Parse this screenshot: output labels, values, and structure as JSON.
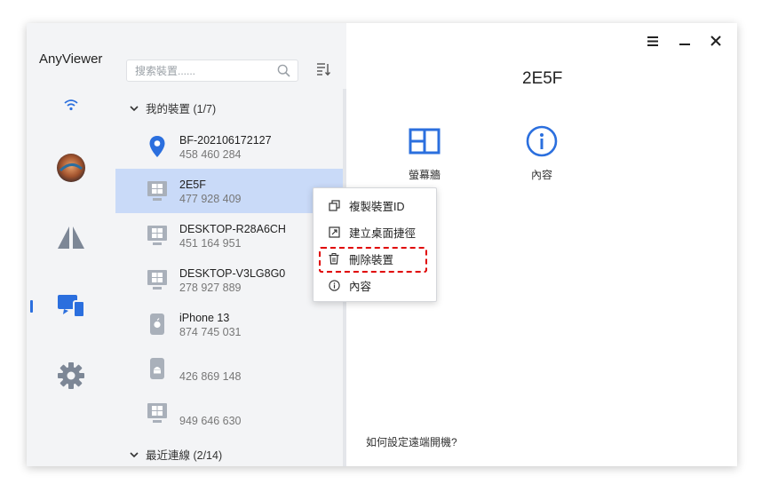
{
  "app": {
    "title": "AnyViewer"
  },
  "rail": {
    "items": [
      {
        "icon": "wifi-icon"
      },
      {
        "icon": "avatar"
      },
      {
        "icon": "remote-control-icon"
      },
      {
        "icon": "devices-icon",
        "active": true
      },
      {
        "icon": "gear-icon"
      }
    ]
  },
  "search": {
    "placeholder": "搜索裝置......",
    "value": ""
  },
  "groups": {
    "my_devices": "我的裝置 (1/7)",
    "recent": "最近連線 (2/14)"
  },
  "devices": [
    {
      "name": "BF-202106172127",
      "id": "458 460 284",
      "icon": "location-pin-icon"
    },
    {
      "name": "2E5F",
      "id": "477 928 409",
      "icon": "windows-pc-icon",
      "selected": true
    },
    {
      "name": "DESKTOP-R28A6CH",
      "id": "451 164 951",
      "icon": "windows-pc-icon"
    },
    {
      "name": "DESKTOP-V3LG8G0",
      "id": "278 927 889",
      "icon": "windows-pc-icon"
    },
    {
      "name": "iPhone 13",
      "id": "874 745 031",
      "icon": "apple-phone-icon"
    },
    {
      "name": "",
      "id": "426 869 148",
      "icon": "android-phone-icon"
    },
    {
      "name": "",
      "id": "949 646 630",
      "icon": "windows-pc-icon"
    }
  ],
  "detail": {
    "title": "2E5F",
    "actions": [
      {
        "label": "螢幕牆",
        "icon": "screen-wall-icon"
      },
      {
        "label": "內容",
        "icon": "info-icon"
      }
    ],
    "help_link": "如何設定遠端開機?"
  },
  "context_menu": {
    "items": [
      {
        "label": "複製裝置ID",
        "icon": "copy-icon"
      },
      {
        "label": "建立桌面捷徑",
        "icon": "shortcut-icon"
      },
      {
        "label": "刪除裝置",
        "icon": "trash-icon",
        "highlighted": true
      },
      {
        "label": "內容",
        "icon": "info-icon"
      }
    ]
  },
  "colors": {
    "accent": "#2b6fde",
    "selected_row": "#c9daf8",
    "highlight_border": "#e00000"
  }
}
